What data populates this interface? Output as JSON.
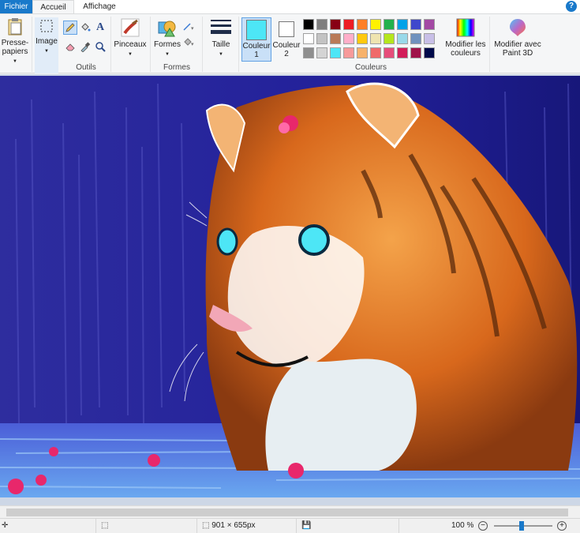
{
  "tabs": {
    "fichier": "Fichier",
    "accueil": "Accueil",
    "affichage": "Affichage"
  },
  "help": "?",
  "clipboard": {
    "label1": "Presse-",
    "label2": "papiers"
  },
  "image": {
    "label": "Image"
  },
  "groups": {
    "outils": "Outils",
    "formes": "Formes",
    "couleurs": "Couleurs"
  },
  "brushes": {
    "label": "Pinceaux"
  },
  "shapes": {
    "label": "Formes"
  },
  "size": {
    "label": "Taille"
  },
  "color1": {
    "label1": "Couleur",
    "label2": "1",
    "value": "#4de6f6"
  },
  "color2": {
    "label1": "Couleur",
    "label2": "2",
    "value": "#ffffff"
  },
  "edit_colors": {
    "label1": "Modifier les",
    "label2": "couleurs"
  },
  "paint3d": {
    "label1": "Modifier avec",
    "label2": "Paint 3D"
  },
  "palette": [
    "#000000",
    "#7f7f7f",
    "#880015",
    "#ed1c24",
    "#ff7f27",
    "#fff200",
    "#22b14c",
    "#00a2e8",
    "#3f48cc",
    "#a349a4",
    "#ffffff",
    "#c3c3c3",
    "#b97a57",
    "#ffaec9",
    "#ffc90e",
    "#efe4b0",
    "#b5e61d",
    "#99d9ea",
    "#7092be",
    "#c8bfe7",
    "#8f8f8f",
    "#d4d4d4",
    "#4de6f6",
    "#f79a9a",
    "#f7b26b",
    "#f06a6a",
    "#e64d7a",
    "#d21e5a",
    "#a0144a",
    "#000a4a"
  ],
  "status": {
    "dimensions": "901 × 655px",
    "zoom": "100 %"
  }
}
